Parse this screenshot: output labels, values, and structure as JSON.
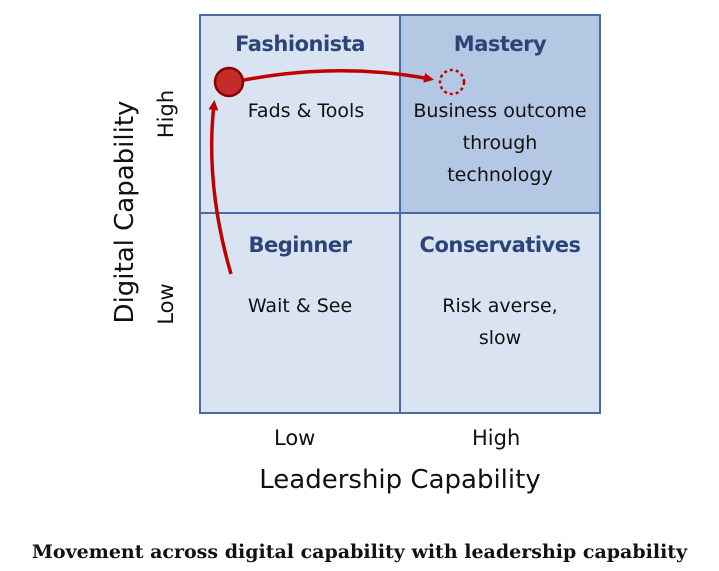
{
  "quadrants": {
    "top_left": {
      "title": "Fashionista",
      "desc": "Fads & Tools"
    },
    "top_right": {
      "title": "Mastery",
      "desc": "Business outcome\nthrough\ntechnology"
    },
    "bottom_left": {
      "title": "Beginner",
      "desc": "Wait & See"
    },
    "bottom_right": {
      "title": "Conservatives",
      "desc": "Risk averse,\nslow"
    }
  },
  "x_axis": {
    "title": "Leadership Capability",
    "low": "Low",
    "high": "High"
  },
  "y_axis": {
    "title": "Digital Capability",
    "low": "Low",
    "high": "High"
  },
  "caption": "Movement across digital capability with leadership capability",
  "colors": {
    "quadrant_light": "#d9e3f2",
    "quadrant_highlight": "#b4c8e4",
    "border": "#4a6aa3",
    "title_text": "#2d4478",
    "arrow": "#c00000"
  }
}
